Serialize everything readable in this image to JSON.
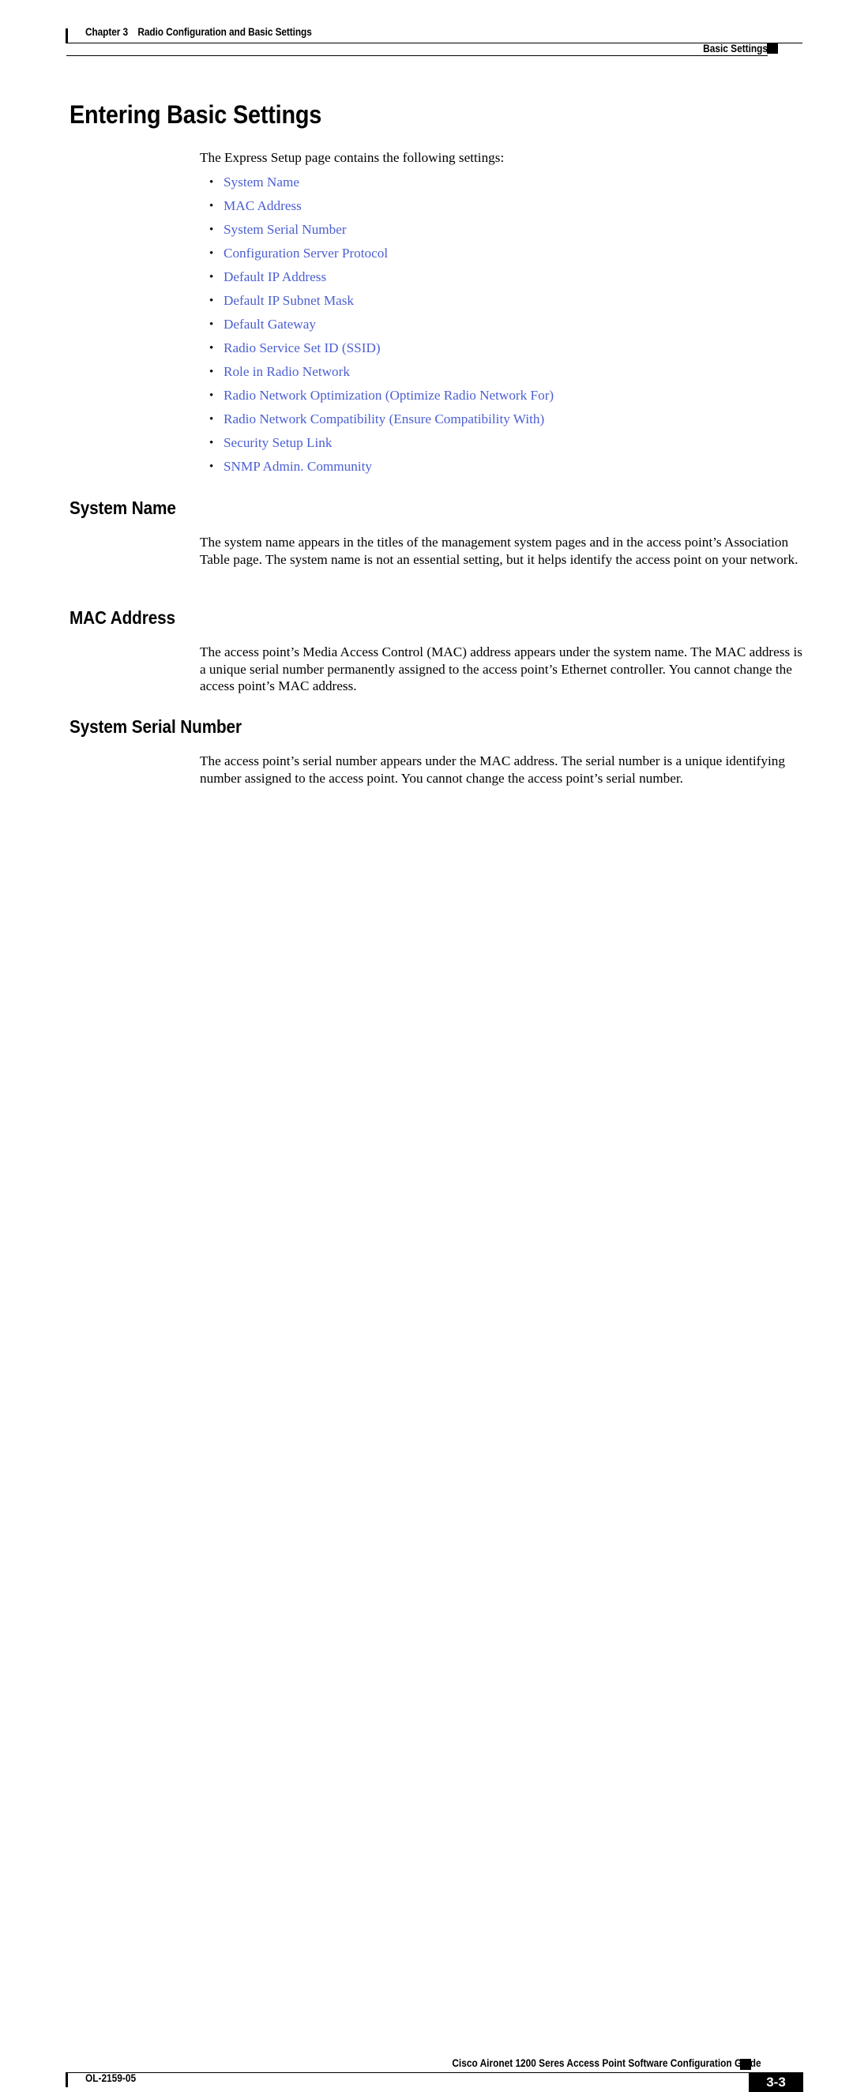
{
  "header": {
    "chapter_number": "Chapter 3",
    "chapter_title": "Radio Configuration and Basic Settings",
    "section_title": "Basic Settings"
  },
  "main": {
    "title": "Entering Basic Settings",
    "intro": "The Express Setup page contains the following settings:",
    "link_list": [
      {
        "label": "System Name"
      },
      {
        "label": "MAC Address"
      },
      {
        "label": "System Serial Number"
      },
      {
        "label": "Configuration Server Protocol"
      },
      {
        "label": "Default IP Address"
      },
      {
        "label": "Default IP Subnet Mask"
      },
      {
        "label": "Default Gateway"
      },
      {
        "label": "Radio Service Set ID (SSID)"
      },
      {
        "label": "Role in Radio Network"
      },
      {
        "label": "Radio Network Optimization (Optimize Radio Network For)"
      },
      {
        "label": "Radio Network Compatibility (Ensure Compatibility With)"
      },
      {
        "label": "Security Setup Link"
      },
      {
        "label": "SNMP Admin. Community"
      }
    ],
    "sections": [
      {
        "heading": "System Name",
        "body": "The system name appears in the titles of the management system pages and in the access point’s Association Table page. The system name is not an essential setting, but it helps identify the access point on your network."
      },
      {
        "heading": "MAC Address",
        "body": "The access point’s Media Access Control (MAC) address appears under the system name. The MAC address is a unique serial number permanently assigned to the access point’s Ethernet controller. You cannot change the access point’s MAC address."
      },
      {
        "heading": "System Serial Number",
        "body": "The access point’s serial number appears under the MAC address. The serial number is a unique identifying number assigned to the access point. You cannot change the access point’s serial number."
      }
    ]
  },
  "footer": {
    "guide_title": "Cisco Aironet 1200 Seres Access Point Software Configuration Guide",
    "doc_id": "OL-2159-05",
    "page_number": "3-3"
  },
  "colors": {
    "link": "#4b5fd1",
    "text": "#000000",
    "page_background": "#ffffff",
    "page_number_background": "#000000",
    "page_number_text": "#ffffff"
  }
}
